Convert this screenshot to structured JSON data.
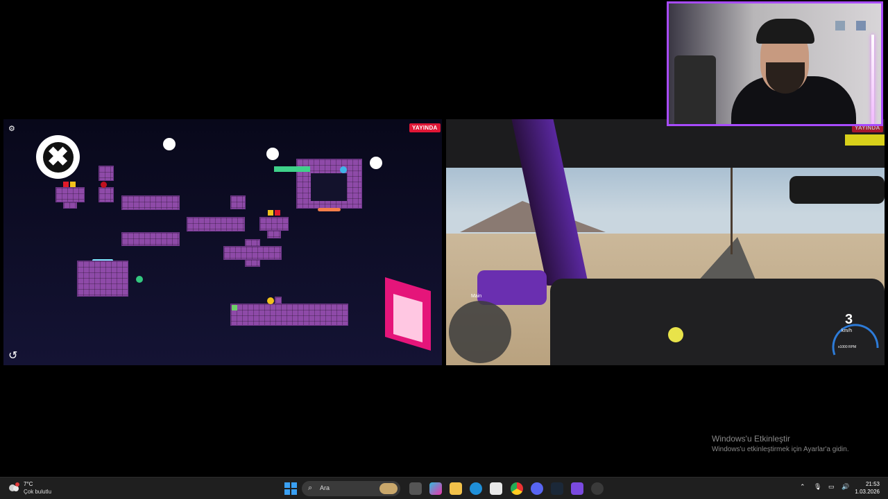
{
  "game": {
    "badge": "YAYINDA",
    "close_label": "✖"
  },
  "drive": {
    "badge": "YAYINDA",
    "minimap_label": "Main",
    "gear": "3",
    "speed_unit": "km/h",
    "rpm_unit": "x1000 RPM"
  },
  "watermark": {
    "title": "Windows'u Etkinleştir",
    "subtitle": "Windows'u etkinleştirmek için Ayarlar'a gidin."
  },
  "taskbar": {
    "weather_temp": "7°C",
    "weather_desc": "Çok bulutlu",
    "search_placeholder": "Ara",
    "time": "21:53",
    "date": "1.03.2026"
  },
  "colors": {
    "accent": "#a84bff",
    "live": "#e01636",
    "block": "#8e4aa8",
    "portal": "#e5157a"
  }
}
